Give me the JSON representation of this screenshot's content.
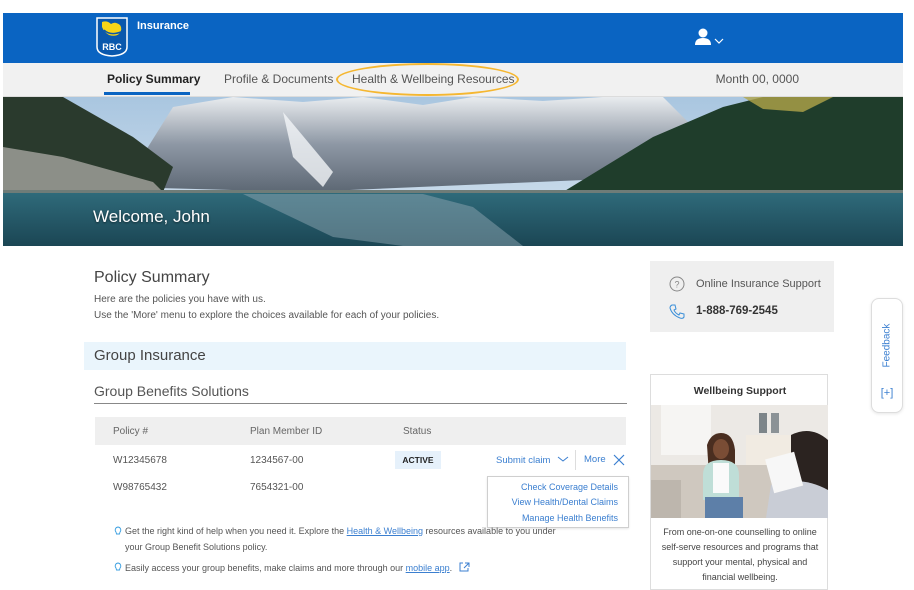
{
  "header": {
    "brand_label": "Insurance",
    "logo_text": "RBC",
    "user_icon": "user-icon",
    "user_menu_icon": "chevron-down-icon",
    "accent_color": "#0a64c2"
  },
  "nav": {
    "tabs": [
      {
        "label": "Policy Summary",
        "active": true
      },
      {
        "label": "Profile & Documents",
        "active": false
      },
      {
        "label": "Health & Wellbeing Resources",
        "active": false,
        "highlighted": true
      }
    ],
    "date": "Month 00, 0000"
  },
  "hero": {
    "welcome": "Welcome, John"
  },
  "policy_summary": {
    "title": "Policy Summary",
    "intro_line1": "Here are the policies you have with us.",
    "intro_line2": "Use the 'More' menu to explore the choices available for each of your policies.",
    "section_title": "Group Insurance",
    "subsection_title": "Group Benefits Solutions",
    "table": {
      "headers": [
        "Policy #",
        "Plan Member ID",
        "Status"
      ],
      "rows": [
        {
          "policy": "W12345678",
          "member_id": "1234567-00",
          "status": "ACTIVE"
        },
        {
          "policy": "W98765432",
          "member_id": "7654321-00",
          "status": ""
        }
      ]
    },
    "actions": {
      "submit_claim": "Submit claim",
      "more": "More",
      "menu_items": [
        "Check Coverage Details",
        "View Health/Dental Claims",
        "Manage Health Benefits"
      ]
    },
    "tips": [
      {
        "before": "Get the right kind of help when you need it. Explore the ",
        "link": "Health & Wellbeing",
        "after": " resources available to you under",
        "line2": "your Group Benefit Solutions policy."
      },
      {
        "before": "Easily access your group benefits, make claims and more through our ",
        "link": "mobile app",
        "after": "."
      }
    ]
  },
  "support": {
    "online_label": "Online Insurance Support",
    "phone": "1-888-769-2545"
  },
  "wellbeing_card": {
    "title": "Wellbeing Support",
    "description": "From one-on-one counselling to online self-serve resources and programs that support your mental, physical and financial wellbeing."
  },
  "feedback": {
    "label": "Feedback",
    "plus": "[+]"
  }
}
